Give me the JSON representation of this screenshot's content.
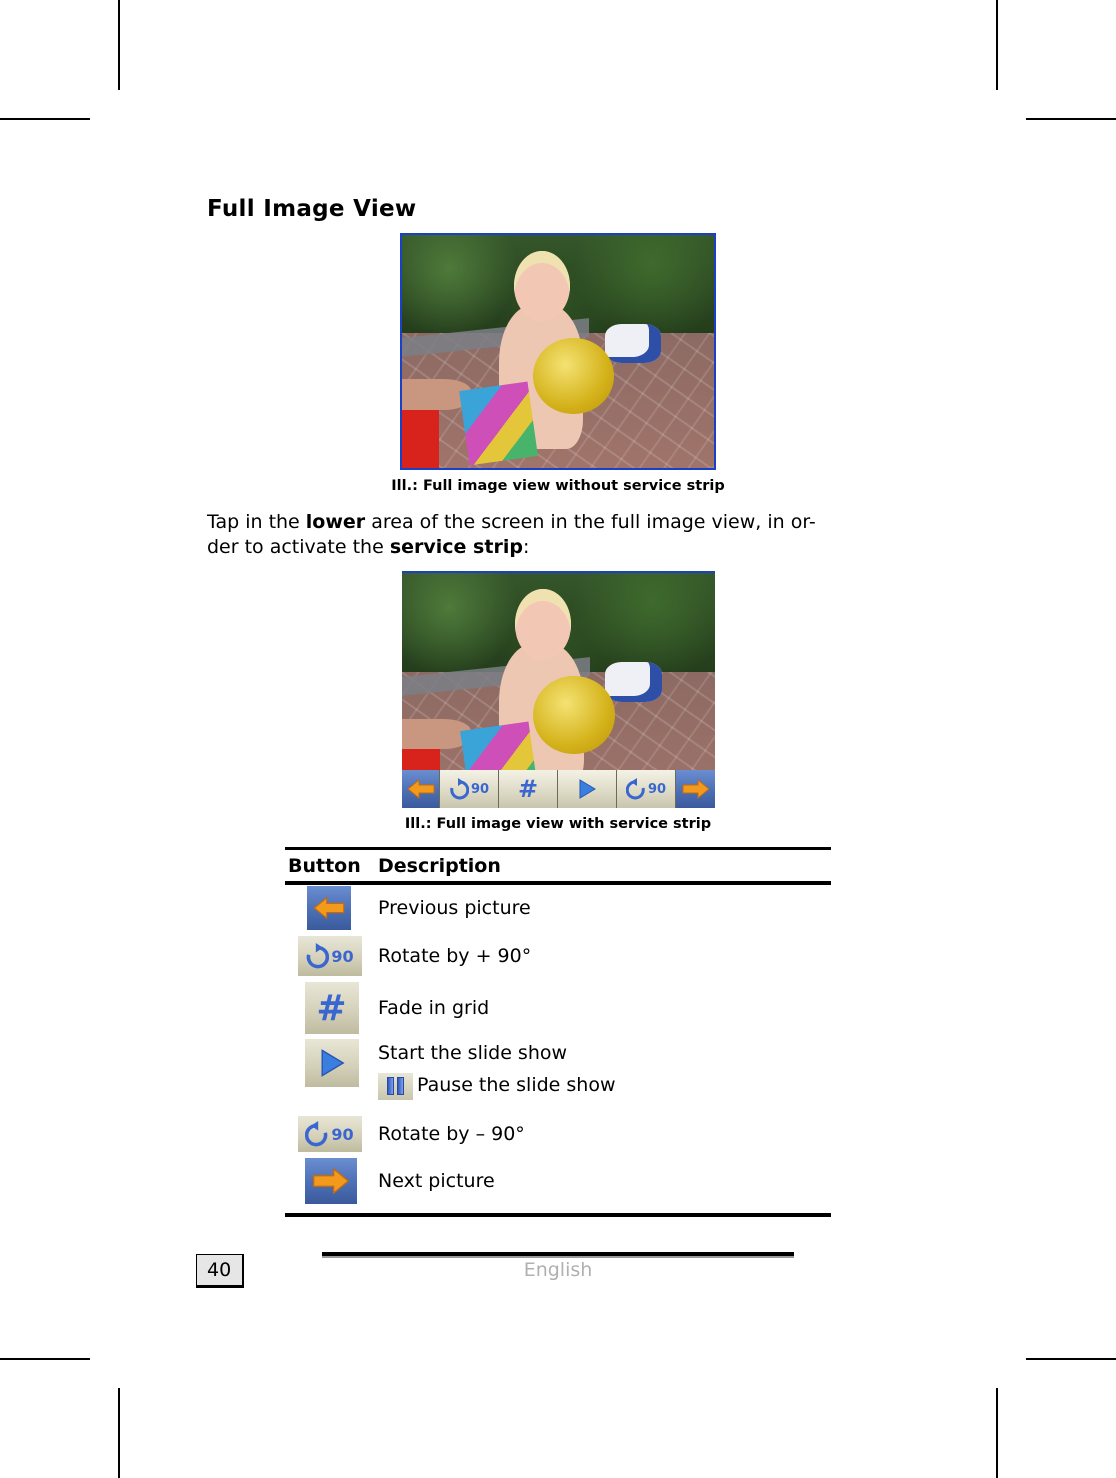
{
  "page": {
    "heading": "Full Image View",
    "figure1": {
      "caption": "Ill.: Full image view without service strip",
      "image_description": "photo of a toddler holding a yellow balloon on a paved patio"
    },
    "instruction": {
      "text_1": "Tap in the ",
      "bold_1": "lower",
      "text_2": " area of the screen in the full image view, in or-",
      "text_3": "der to activate the ",
      "bold_2": "service strip",
      "text_4": ":"
    },
    "figure2": {
      "caption": "Ill.: Full image view with service strip",
      "image_description": "same photo with service strip buttons along the bottom",
      "strip_buttons": [
        {
          "icon": "arrow-left-icon",
          "label": ""
        },
        {
          "icon": "rotate-clockwise-icon",
          "label": "90"
        },
        {
          "icon": "grid-icon",
          "label": ""
        },
        {
          "icon": "play-icon",
          "label": ""
        },
        {
          "icon": "rotate-counterclockwise-icon",
          "label": "90"
        },
        {
          "icon": "arrow-right-icon",
          "label": ""
        }
      ]
    },
    "table": {
      "headers": {
        "button": "Button",
        "description": "Description"
      },
      "rows": [
        {
          "icon": "arrow-left-icon",
          "description": "Previous picture"
        },
        {
          "icon": "rotate-clockwise-icon",
          "icon_label": "90",
          "description": "Rotate by + 90°"
        },
        {
          "icon": "grid-icon",
          "description": "Fade in grid"
        },
        {
          "icon": "play-icon",
          "description": "Start the slide show",
          "sub_icon": "pause-icon",
          "sub_description": "Pause the slide show"
        },
        {
          "icon": "rotate-counterclockwise-icon",
          "icon_label": "90",
          "description": "Rotate by – 90°"
        },
        {
          "icon": "arrow-right-icon",
          "description": "Next picture"
        }
      ]
    },
    "footer": {
      "page_number": "40",
      "language": "English"
    },
    "colors": {
      "frame_blue": "#1a40c8",
      "button_blue": "#4c6fb4",
      "arrow_orange": "#f29a1c",
      "icon_blue": "#3a66d0",
      "button_beige": "#dcd9c4"
    }
  }
}
